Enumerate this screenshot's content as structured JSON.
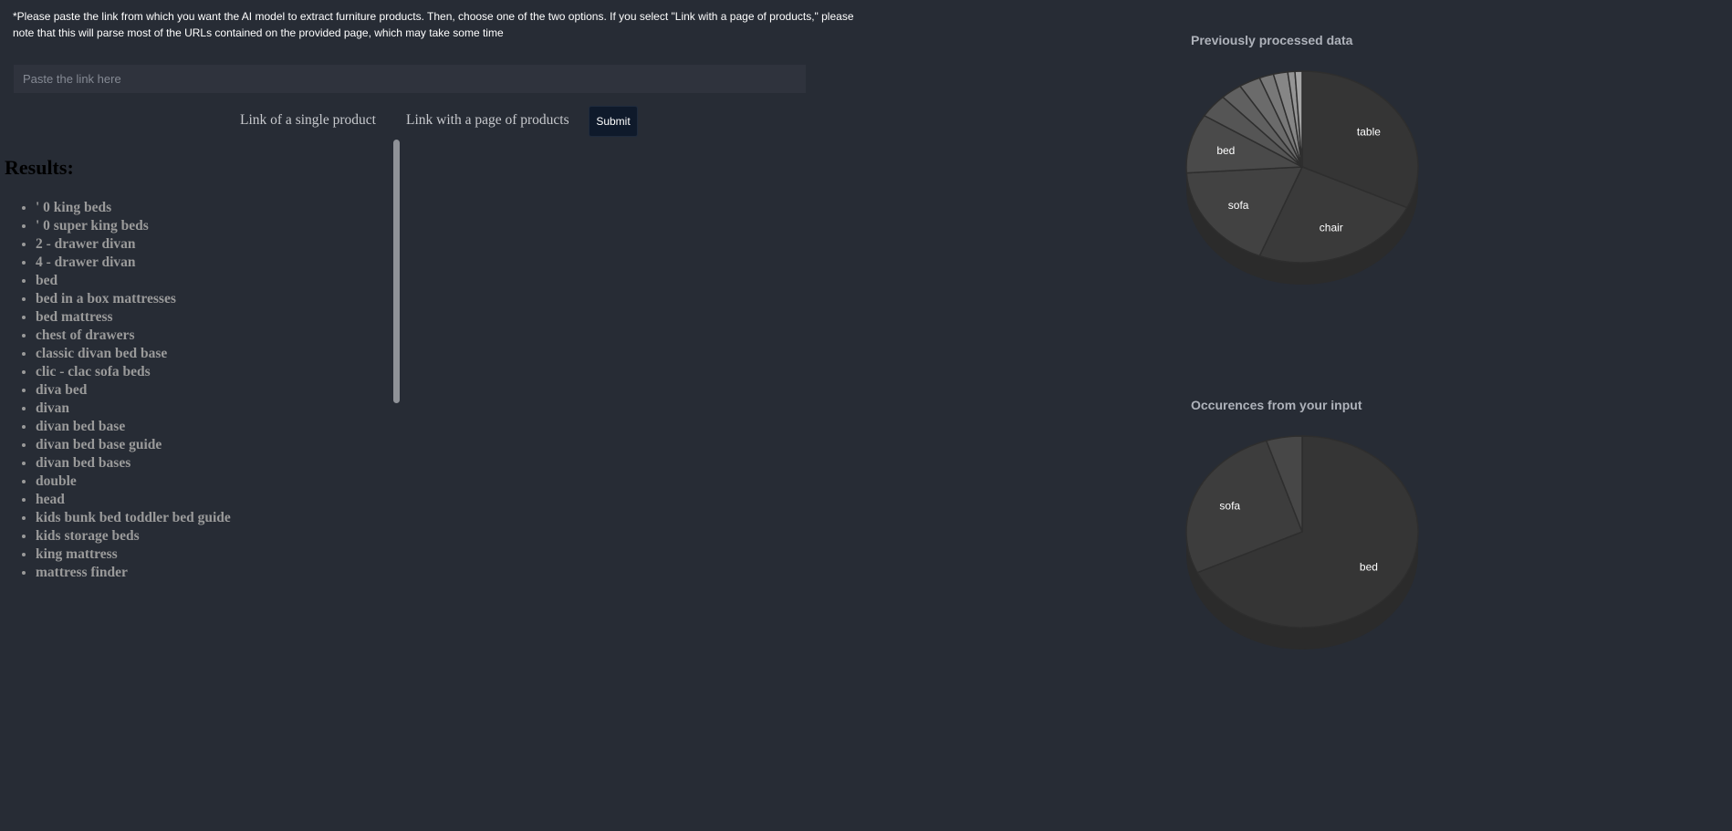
{
  "instructions": "*Please paste the link from which you want the AI model to extract furniture products. Then, choose one of the two options. If you select \"Link with a page of products,\" please note that this will parse most of the URLs contained on the provided page, which may take some time",
  "link_input": {
    "placeholder": "Paste the link here",
    "value": ""
  },
  "options": {
    "single": "Link of a single product",
    "page": "Link with a page of products"
  },
  "submit_label": "Submit",
  "results": {
    "heading": "Results:",
    "items": [
      "' 0 king beds",
      "' 0 super king beds",
      "2 - drawer divan",
      "4 - drawer divan",
      "bed",
      "bed in a box mattresses",
      "bed mattress",
      "chest of drawers",
      "classic divan bed base",
      "clic - clac sofa beds",
      "diva bed",
      "divan",
      "divan bed base",
      "divan bed base guide",
      "divan bed bases",
      "double",
      "head",
      "kids bunk bed toddler bed guide",
      "kids storage beds",
      "king mattress",
      "mattress finder"
    ]
  },
  "chart_data": [
    {
      "type": "pie",
      "title": "Previously processed data",
      "labels": [
        "table",
        "chair",
        "sofa",
        "bed",
        "",
        "",
        "",
        "",
        "",
        "",
        ""
      ],
      "values": [
        32,
        24,
        18,
        10,
        4,
        3,
        3,
        2,
        2,
        1,
        1
      ],
      "colors": [
        "#353535",
        "#3a3a3a",
        "#424242",
        "#4a4a4a",
        "#555555",
        "#606060",
        "#6b6b6b",
        "#787878",
        "#868686",
        "#959595",
        "#a5a5a5"
      ]
    },
    {
      "type": "pie",
      "title": "Occurences from your input",
      "labels": [
        "bed",
        "sofa",
        ""
      ],
      "values": [
        68,
        27,
        5
      ],
      "colors": [
        "#353535",
        "#3d3d3d",
        "#474747"
      ]
    }
  ]
}
